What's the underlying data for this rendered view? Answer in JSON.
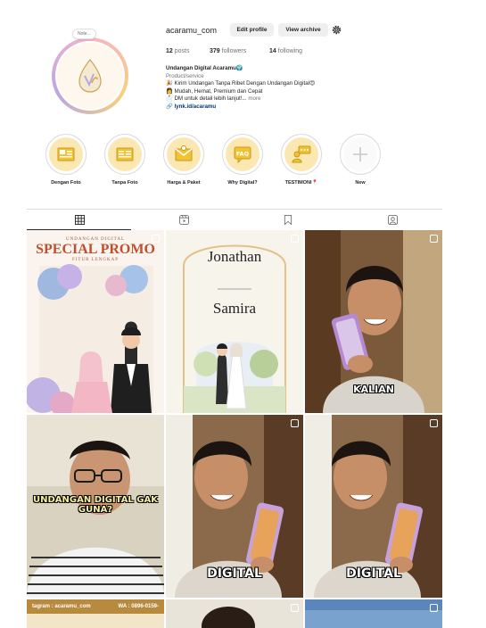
{
  "profile": {
    "username": "acaramu_com",
    "edit_label": "Edit profile",
    "archive_label": "View archive",
    "note_label": "Note...",
    "stats": {
      "posts_count": "12",
      "posts_label": "posts",
      "followers_count": "379",
      "followers_label": "followers",
      "following_count": "14",
      "following_label": "following"
    },
    "bio": {
      "name": "Undangan Digital Acaramu",
      "category": "Product/service",
      "line1": "Kirim Undangan Tanpa Ribet Dengan Undangan Digital",
      "line2": "Mudah, Hemat, Premium dan Cepat",
      "line3": "DM untuk detail lebih lanjut!...",
      "more": "more",
      "link": "lynk.id/acaramu"
    }
  },
  "highlights": [
    {
      "label": "Dengan Foto",
      "icon": "invitation-card-icon"
    },
    {
      "label": "Tanpa Foto",
      "icon": "invitation-card-icon"
    },
    {
      "label": "Harga & Paket",
      "icon": "envelope-icon"
    },
    {
      "label": "Why Digital?",
      "icon": "faq-icon"
    },
    {
      "label": "TESTIMONI📍",
      "icon": "testimonial-icon"
    },
    {
      "label": "New",
      "icon": "plus-icon"
    }
  ],
  "tabs": [
    "posts-grid-icon",
    "reels-icon",
    "saved-icon",
    "tagged-icon"
  ],
  "posts": {
    "promo": {
      "small": "UNDANGAN DIGITAL",
      "title": "SPECIAL PROMO",
      "sub": "FITUR LENGKAP"
    },
    "wedding": {
      "name1": "Jonathan",
      "name2": "Samira"
    },
    "captions": {
      "kalian": "KALIAN",
      "gak_guna": "UNDANGAN DIGITAL GAK GUNA?",
      "digital_a": "DIGITAL",
      "digital_b": "DIGITAL"
    },
    "contact_bar": {
      "left": "tagram : acaramu_com",
      "right": "WA : 0896-0159-"
    }
  },
  "colors": {
    "accent_link": "#00376b",
    "button_bg": "#efefef",
    "highlight_bg": "#fbe7b2",
    "promo_red": "#c0502d"
  }
}
